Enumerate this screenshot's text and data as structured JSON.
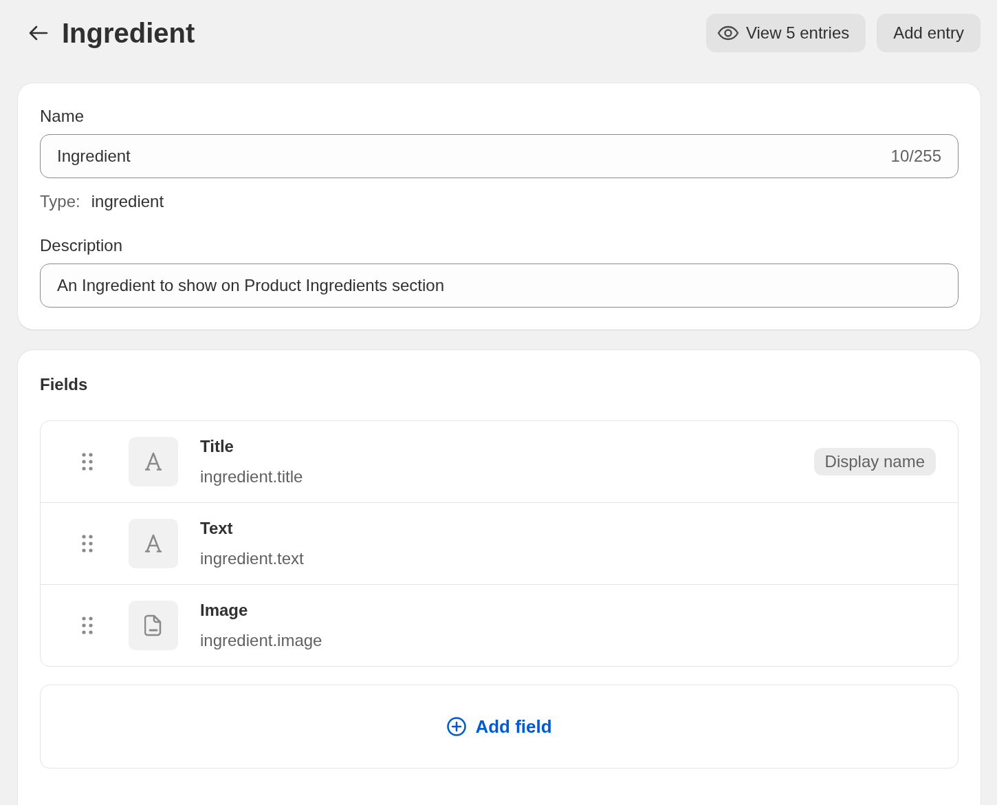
{
  "header": {
    "title": "Ingredient",
    "buttons": [
      {
        "label": "View 5 entries",
        "kind": "view"
      },
      {
        "label": "Add entry",
        "kind": "plain"
      }
    ]
  },
  "details": {
    "name_label": "Name",
    "name_value": "Ingredient",
    "name_counter": "10/255",
    "type_label": "Type:",
    "type_value": "ingredient",
    "description_label": "Description",
    "description_value": "An Ingredient to show on Product Ingredients section"
  },
  "fields_section": {
    "title": "Fields",
    "fields": [
      {
        "name": "Title",
        "key": "ingredient.title",
        "kind": "text",
        "badge": "Display name"
      },
      {
        "name": "Text",
        "key": "ingredient.text",
        "kind": "text"
      },
      {
        "name": "Image",
        "key": "ingredient.image",
        "kind": "file"
      }
    ],
    "add_button": "Add field"
  }
}
